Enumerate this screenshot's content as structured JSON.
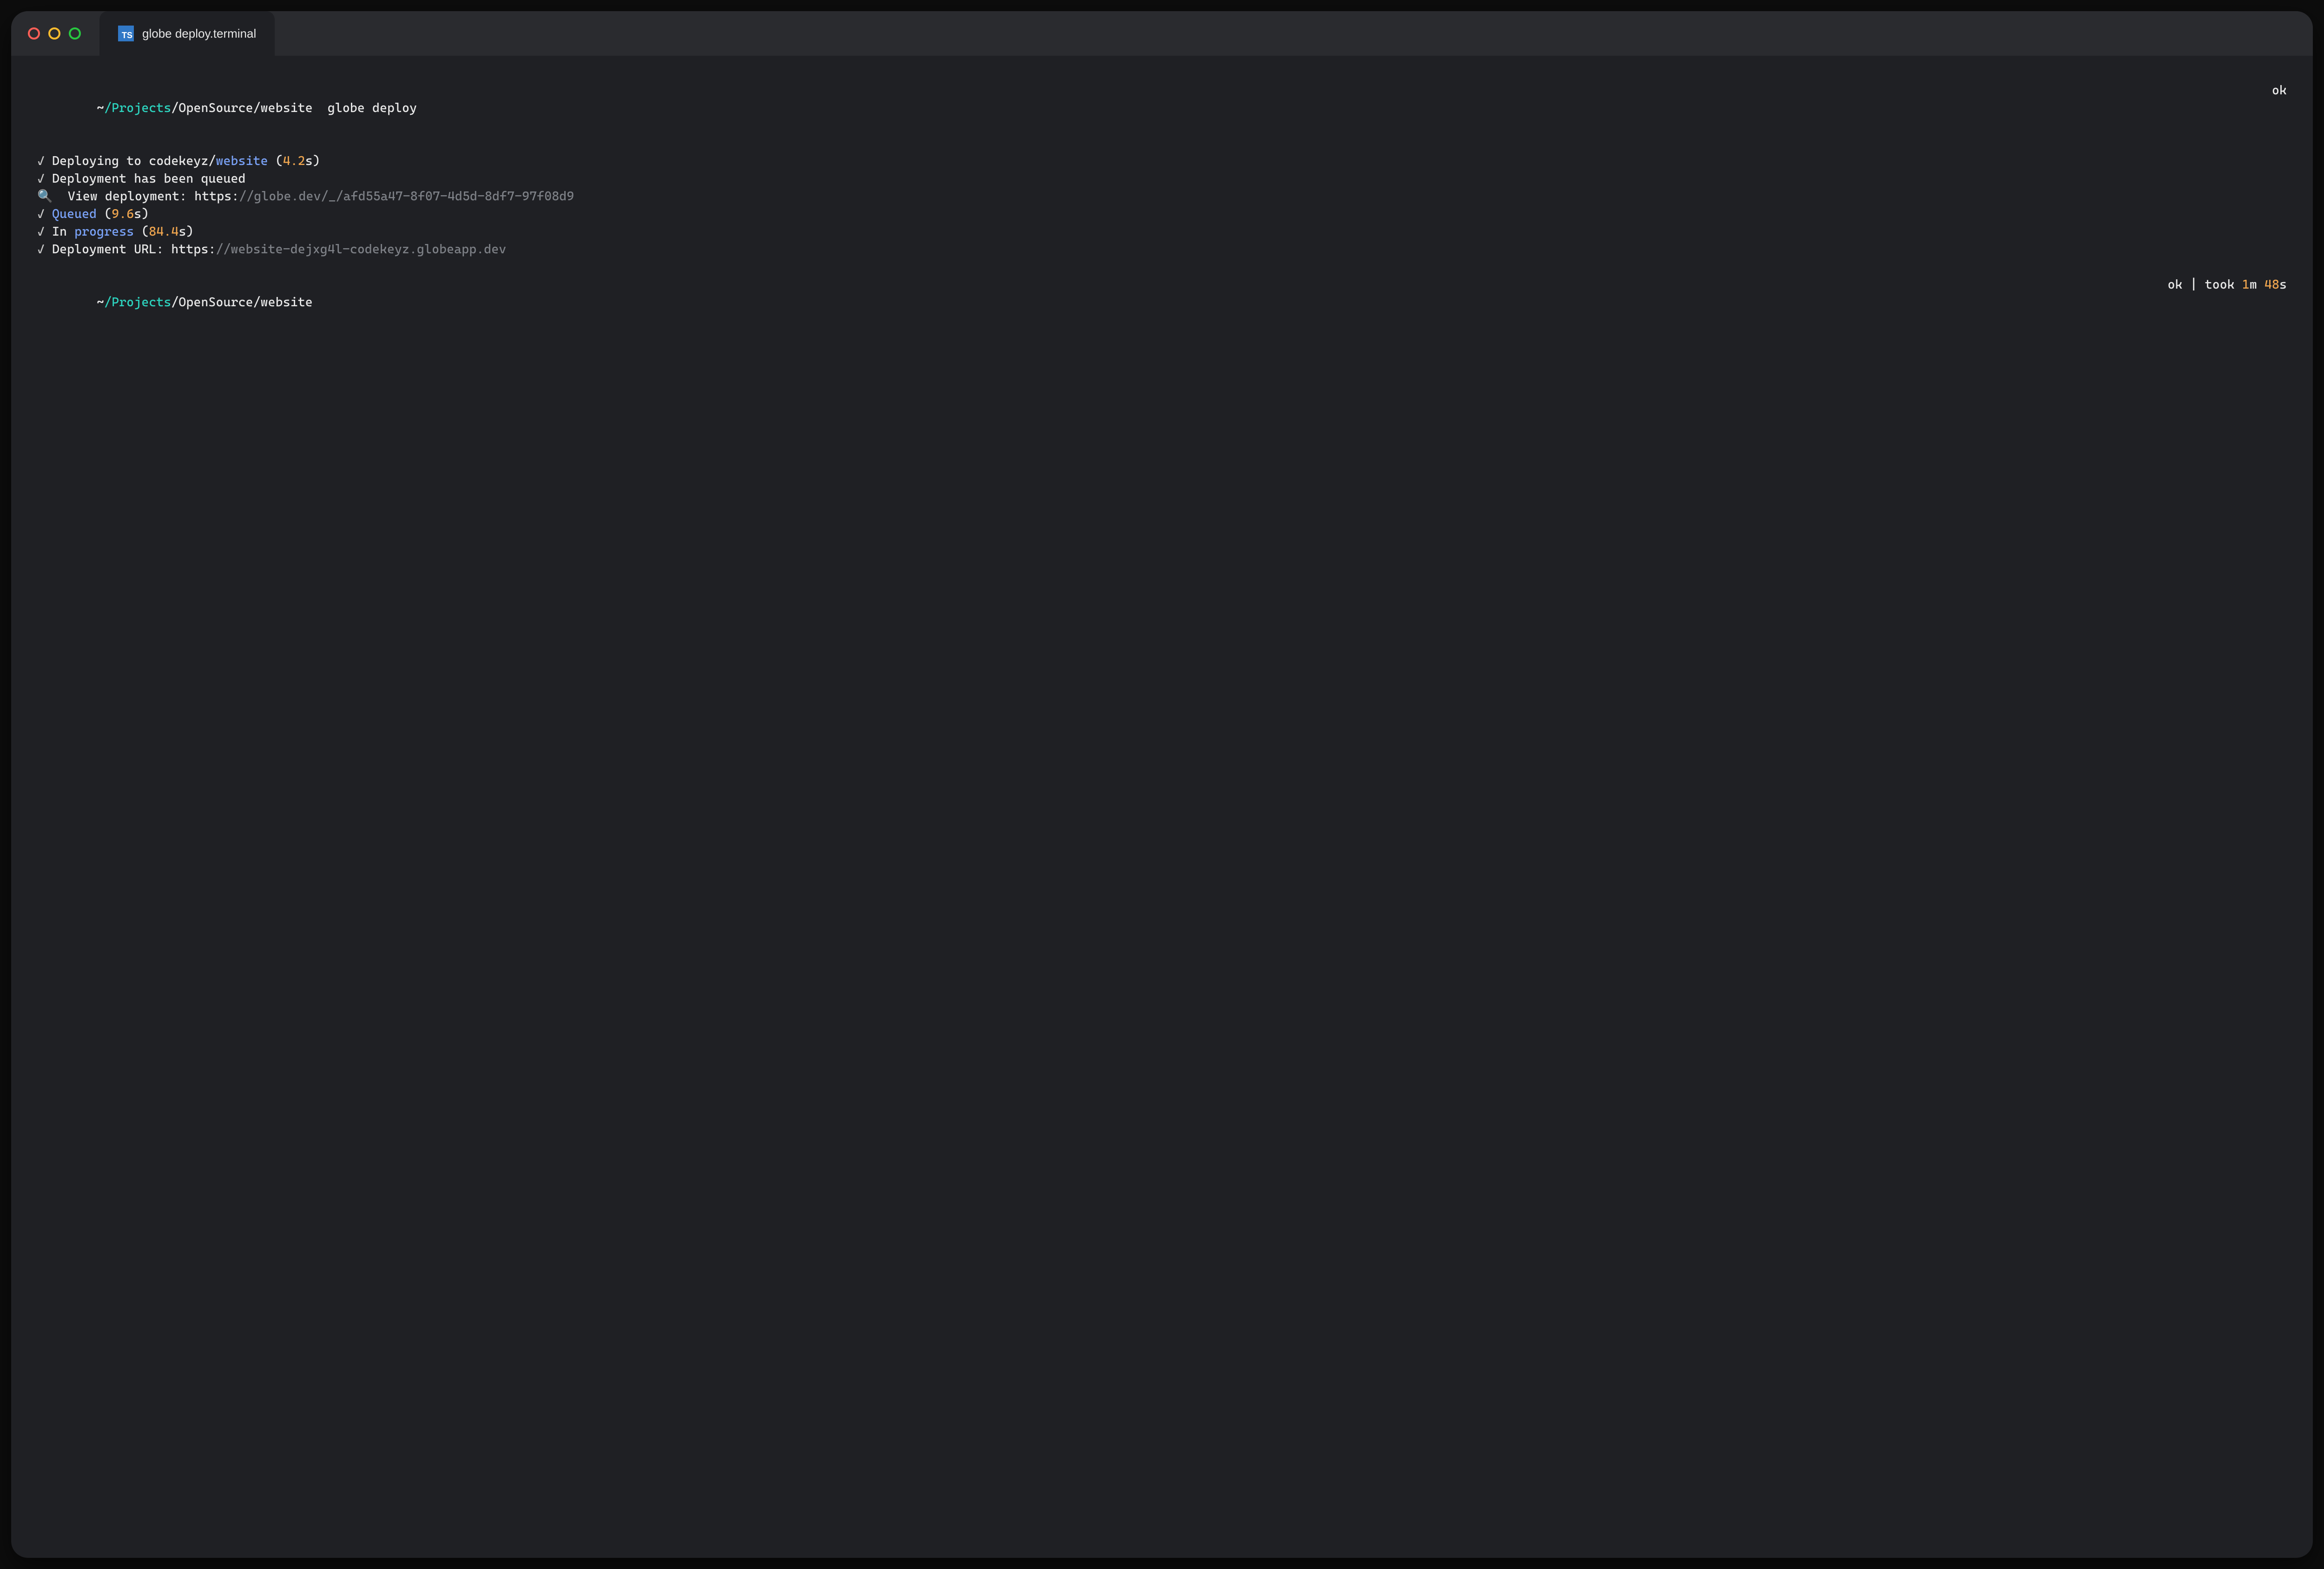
{
  "tab": {
    "icon": "TS",
    "title": "globe deploy.terminal"
  },
  "prompt1": {
    "tilde": "~",
    "slash": "/",
    "projects": "Projects",
    "path_rest": "/OpenSource/website",
    "command": "globe deploy",
    "status": "ok"
  },
  "output": {
    "l1": {
      "check": "✓",
      "text1": " Deploying to codekeyz/",
      "website": "website",
      "paren_open": " (",
      "time": "4.2",
      "s_close": "s)"
    },
    "l2": {
      "check": "✓",
      "text": " Deployment has been queued"
    },
    "l3": {
      "icon": "🔍",
      "label": "  View deployment: https:",
      "url": "//globe.dev/_/afd55a47-8f07-4d5d-8df7-97f08d9"
    },
    "l4": {
      "check": "✓",
      "space": " ",
      "queued": "Queued",
      "paren_open": " (",
      "time": "9.6",
      "s_close": "s)"
    },
    "l5": {
      "check": "✓",
      "text1": " In ",
      "progress": "progress",
      "paren_open": " (",
      "time": "84.4",
      "s_close": "s)"
    },
    "l6": {
      "check": "✓",
      "label": " Deployment URL: https:",
      "url": "//website-dejxg4l-codekeyz.globeapp.dev"
    }
  },
  "prompt2": {
    "tilde": "~",
    "slash": "/",
    "projects": "Projects",
    "path_rest": "/OpenSource/website",
    "status_ok": "ok",
    "pipe": " | ",
    "took": "took ",
    "min": "1",
    "m": "m ",
    "sec": "48",
    "s": "s"
  }
}
